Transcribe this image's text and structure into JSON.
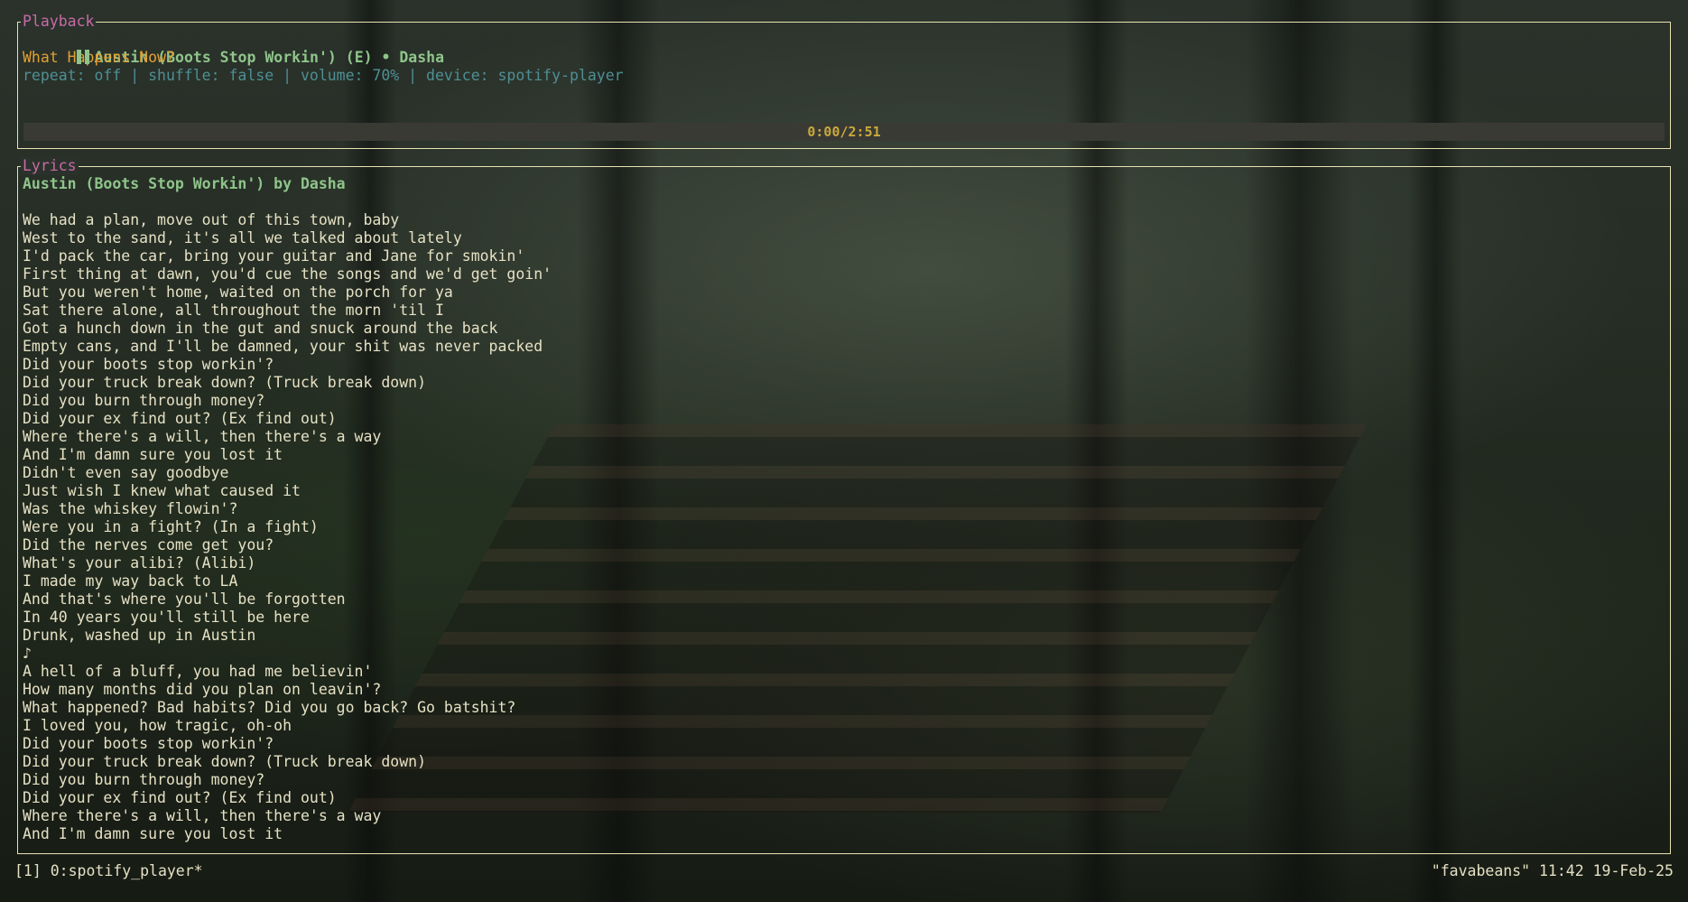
{
  "playback": {
    "panel_title": "Playback",
    "state_icon": "pause-icon",
    "track_line": "Austin (Boots Stop Workin') (E) • Dasha",
    "album": "What Happens Now?",
    "status_line": "repeat: off | shuffle: false | volume: 70% | device: spotify-player",
    "progress": {
      "label": "0:00/2:51",
      "fraction": 0
    }
  },
  "lyrics": {
    "panel_title": "Lyrics",
    "heading": "Austin (Boots Stop Workin') by Dasha",
    "lines": [
      "",
      "We had a plan, move out of this town, baby",
      "West to the sand, it's all we talked about lately",
      "I'd pack the car, bring your guitar and Jane for smokin'",
      "First thing at dawn, you'd cue the songs and we'd get goin'",
      "But you weren't home, waited on the porch for ya",
      "Sat there alone, all throughout the morn 'til I",
      "Got a hunch down in the gut and snuck around the back",
      "Empty cans, and I'll be damned, your shit was never packed",
      "Did your boots stop workin'?",
      "Did your truck break down? (Truck break down)",
      "Did you burn through money?",
      "Did your ex find out? (Ex find out)",
      "Where there's a will, then there's a way",
      "And I'm damn sure you lost it",
      "Didn't even say goodbye",
      "Just wish I knew what caused it",
      "Was the whiskey flowin'?",
      "Were you in a fight? (In a fight)",
      "Did the nerves come get you?",
      "What's your alibi? (Alibi)",
      "I made my way back to LA",
      "And that's where you'll be forgotten",
      "In 40 years you'll still be here",
      "Drunk, washed up in Austin",
      "♪",
      "A hell of a bluff, you had me believin'",
      "How many months did you plan on leavin'?",
      "What happened? Bad habits? Did you go back? Go batshit?",
      "I loved you, how tragic, oh-oh",
      "Did your boots stop workin'?",
      "Did your truck break down? (Truck break down)",
      "Did you burn through money?",
      "Did your ex find out? (Ex find out)",
      "Where there's a will, then there's a way",
      "And I'm damn sure you lost it"
    ]
  },
  "tmux": {
    "left": "[1] 0:spotify_player*",
    "right": "\"favabeans\" 11:42 19-Feb-25"
  },
  "colors": {
    "border": "#e9e2b2",
    "panel_title": "#c86aa6",
    "track": "#8fc48a",
    "album": "#e3a033",
    "status": "#4f8f94",
    "progress_text": "#c9a93a"
  }
}
